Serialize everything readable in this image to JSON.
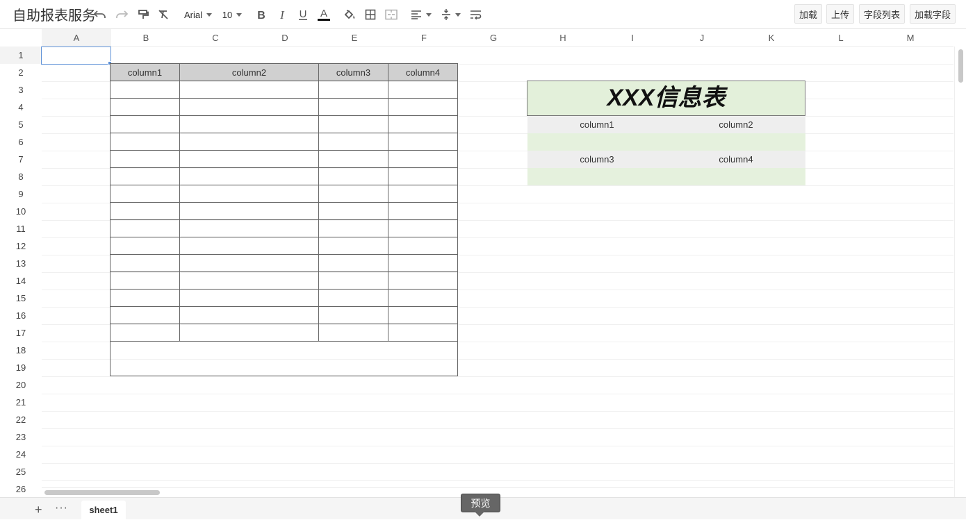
{
  "app": {
    "title": "自助报表服务"
  },
  "toolbar": {
    "font_name": "Arial",
    "font_size": "10",
    "buttons": {
      "load": "加载",
      "upload": "上传",
      "field_list": "字段列表",
      "load_fields": "加载字段"
    }
  },
  "columns": [
    "A",
    "B",
    "C",
    "D",
    "E",
    "F",
    "G",
    "H",
    "I",
    "J",
    "K",
    "L",
    "M"
  ],
  "rows": [
    "1",
    "2",
    "3",
    "4",
    "5",
    "6",
    "7",
    "8",
    "9",
    "10",
    "11",
    "12",
    "13",
    "14",
    "15",
    "16",
    "17",
    "18",
    "19",
    "20",
    "21",
    "22",
    "23",
    "24",
    "25",
    "26"
  ],
  "table1": {
    "headers": [
      "column1",
      "column2",
      "column3",
      "column4"
    ]
  },
  "card": {
    "title": "XXX信息表",
    "row1": [
      "column1",
      "column2"
    ],
    "row2": [
      "column3",
      "column4"
    ]
  },
  "sheets": {
    "active": "sheet1"
  },
  "preview_label": "预览"
}
